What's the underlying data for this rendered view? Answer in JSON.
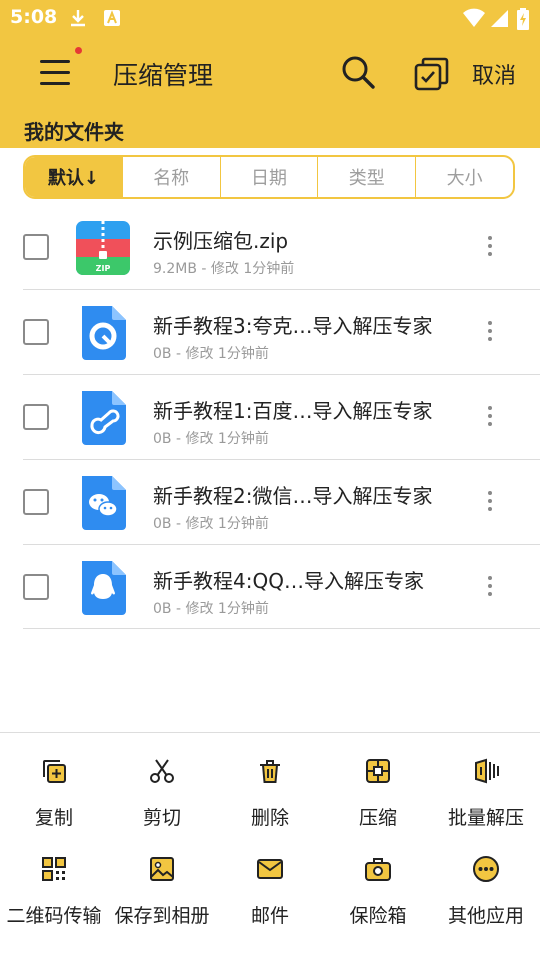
{
  "status_bar": {
    "time": "5:08"
  },
  "app_bar": {
    "title": "压缩管理",
    "cancel_label": "取消"
  },
  "folder_label": "我的文件夹",
  "sort_tabs": [
    "默认↓",
    "名称",
    "日期",
    "类型",
    "大小"
  ],
  "files": [
    {
      "name": "示例压缩包.zip",
      "meta": "9.2MB - 修改 1分钟前",
      "icon": "zip-icon",
      "checked": false
    },
    {
      "name": "新手教程3:夸克…导入解压专家",
      "meta": "0B - 修改 1分钟前",
      "icon": "quark-doc-icon",
      "checked": false
    },
    {
      "name": "新手教程1:百度…导入解压专家",
      "meta": "0B - 修改 1分钟前",
      "icon": "baidu-doc-icon",
      "checked": false
    },
    {
      "name": "新手教程2:微信…导入解压专家",
      "meta": "0B - 修改 1分钟前",
      "icon": "wechat-doc-icon",
      "checked": false
    },
    {
      "name": "新手教程4:QQ…导入解压专家",
      "meta": "0B - 修改 1分钟前",
      "icon": "qq-doc-icon",
      "checked": false
    }
  ],
  "actions": [
    {
      "label": "复制",
      "icon": "copy-icon"
    },
    {
      "label": "剪切",
      "icon": "scissors-icon"
    },
    {
      "label": "删除",
      "icon": "trash-icon"
    },
    {
      "label": "压缩",
      "icon": "compress-icon"
    },
    {
      "label": "批量解压",
      "icon": "batch-extract-icon"
    },
    {
      "label": "二维码传输",
      "icon": "qr-code-icon"
    },
    {
      "label": "保存到相册",
      "icon": "image-icon"
    },
    {
      "label": "邮件",
      "icon": "mail-icon"
    },
    {
      "label": "保险箱",
      "icon": "safe-icon"
    },
    {
      "label": "其他应用",
      "icon": "more-apps-icon"
    }
  ],
  "colors": {
    "accent": "#f2c641",
    "doc_blue": "#2f8cf0",
    "zip_green": "#3cc86a",
    "zip_red": "#f0505a",
    "zip_blue": "#2ea0f0"
  }
}
